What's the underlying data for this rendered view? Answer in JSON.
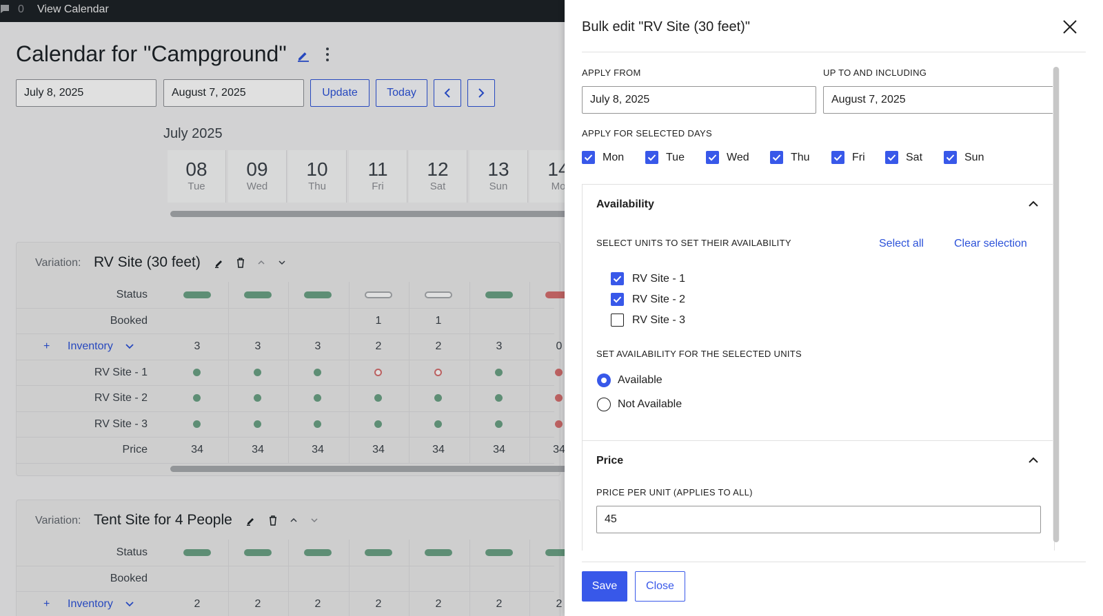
{
  "admin_bar": {
    "comment_count": "0",
    "view_calendar": "View Calendar"
  },
  "calendar": {
    "title": "Calendar for \"Campground\"",
    "date_from": "July 8, 2025",
    "date_to": "August 7, 2025",
    "update_label": "Update",
    "today_label": "Today",
    "month_label": "July 2025",
    "days": [
      {
        "num": "08",
        "wd": "Tue"
      },
      {
        "num": "09",
        "wd": "Wed"
      },
      {
        "num": "10",
        "wd": "Thu"
      },
      {
        "num": "11",
        "wd": "Fri"
      },
      {
        "num": "12",
        "wd": "Sat"
      },
      {
        "num": "13",
        "wd": "Sun"
      },
      {
        "num": "14",
        "wd": "Mo"
      }
    ],
    "variation_label": "Variation:",
    "row_labels": {
      "status": "Status",
      "booked": "Booked",
      "inventory": "Inventory",
      "price": "Price",
      "plus": "+"
    },
    "variations": [
      {
        "name": "RV Site (30 feet)",
        "booked": [
          "",
          "",
          "",
          "1",
          "1",
          "",
          ""
        ],
        "inventory": [
          "3",
          "3",
          "3",
          "2",
          "2",
          "3",
          "0"
        ],
        "units": [
          "RV Site - 1",
          "RV Site - 2",
          "RV Site - 3"
        ],
        "prices": [
          "34",
          "34",
          "34",
          "34",
          "34",
          "34",
          "34"
        ]
      },
      {
        "name": "Tent Site for 4 People",
        "booked": [
          "",
          "",
          "",
          "",
          "",
          "",
          ""
        ],
        "inventory": [
          "2",
          "2",
          "2",
          "2",
          "2",
          "2",
          "2"
        ]
      }
    ]
  },
  "modal": {
    "title": "Bulk edit \"RV Site (30 feet)\"",
    "apply_from_label": "APPLY FROM",
    "apply_from_value": "July 8, 2025",
    "up_to_label": "UP TO AND INCLUDING",
    "up_to_value": "August 7, 2025",
    "days_label": "APPLY FOR SELECTED DAYS",
    "days": [
      {
        "label": "Mon",
        "checked": true
      },
      {
        "label": "Tue",
        "checked": true
      },
      {
        "label": "Wed",
        "checked": true
      },
      {
        "label": "Thu",
        "checked": true
      },
      {
        "label": "Fri",
        "checked": true
      },
      {
        "label": "Sat",
        "checked": true
      },
      {
        "label": "Sun",
        "checked": true
      }
    ],
    "availability": {
      "title": "Availability",
      "select_units_label": "SELECT UNITS TO SET THEIR AVAILABILITY",
      "select_all": "Select all",
      "clear_selection": "Clear selection",
      "units": [
        {
          "label": "RV Site - 1",
          "checked": true
        },
        {
          "label": "RV Site - 2",
          "checked": true
        },
        {
          "label": "RV Site - 3",
          "checked": false
        }
      ],
      "set_label": "SET AVAILABILITY FOR THE SELECTED UNITS",
      "options": [
        {
          "label": "Available",
          "selected": true
        },
        {
          "label": "Not Available",
          "selected": false
        }
      ]
    },
    "price": {
      "title": "Price",
      "per_unit_label": "PRICE PER UNIT (APPLIES TO ALL)",
      "value": "45"
    },
    "save_label": "Save",
    "close_label": "Close"
  },
  "colors": {
    "accent": "#3858e9",
    "link": "#2c52d9",
    "status_available": "#6ca286",
    "status_unavailable": "#d56f6f"
  }
}
